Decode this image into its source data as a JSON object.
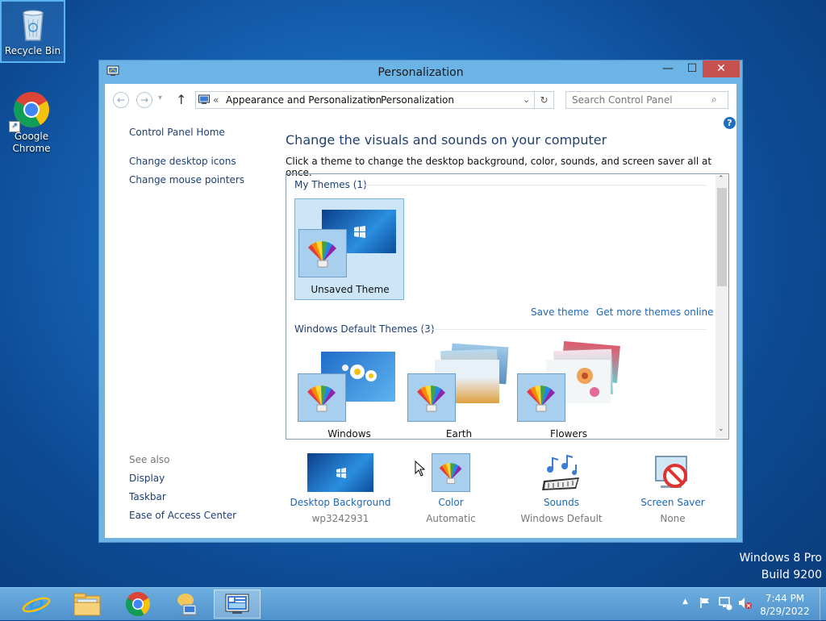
{
  "desktop": {
    "icons": [
      {
        "label": "Recycle Bin"
      },
      {
        "label": "Google Chrome"
      }
    ],
    "watermark_line1": "Windows 8 Pro",
    "watermark_line2": "Build 9200"
  },
  "window": {
    "title": "Personalization",
    "breadcrumb_prefix": "«",
    "breadcrumb": [
      "Appearance and Personalization",
      "Personalization"
    ],
    "search_placeholder": "Search Control Panel",
    "help_icon": "?"
  },
  "sidebar": {
    "home": "Control Panel Home",
    "links": [
      "Change desktop icons",
      "Change mouse pointers"
    ],
    "see_also_label": "See also",
    "see_also": [
      "Display",
      "Taskbar",
      "Ease of Access Center"
    ]
  },
  "main": {
    "heading": "Change the visuals and sounds on your computer",
    "description": "Click a theme to change the desktop background, color, sounds, and screen saver all at once.",
    "my_themes_label": "My Themes (1)",
    "my_themes": [
      {
        "name": "Unsaved Theme",
        "selected": true
      }
    ],
    "save_theme": "Save theme",
    "get_more": "Get more themes online",
    "default_themes_label": "Windows Default Themes (3)",
    "default_themes": [
      {
        "name": "Windows"
      },
      {
        "name": "Earth"
      },
      {
        "name": "Flowers"
      }
    ]
  },
  "bottom": [
    {
      "label": "Desktop Background",
      "value": "wp3242931",
      "icon": "desktop-background-icon"
    },
    {
      "label": "Color",
      "value": "Automatic",
      "icon": "color-icon"
    },
    {
      "label": "Sounds",
      "value": "Windows Default",
      "icon": "sounds-icon"
    },
    {
      "label": "Screen Saver",
      "value": "None",
      "icon": "screen-saver-icon"
    }
  ],
  "taskbar": {
    "apps": [
      "internet-explorer-icon",
      "file-explorer-icon",
      "chrome-icon",
      "network-icon",
      "control-panel-icon"
    ],
    "time": "7:44 PM",
    "date": "8/29/2022"
  },
  "colors": {
    "accent": "#6cb3e6",
    "close": "#c75050",
    "link": "#1c68b5"
  }
}
